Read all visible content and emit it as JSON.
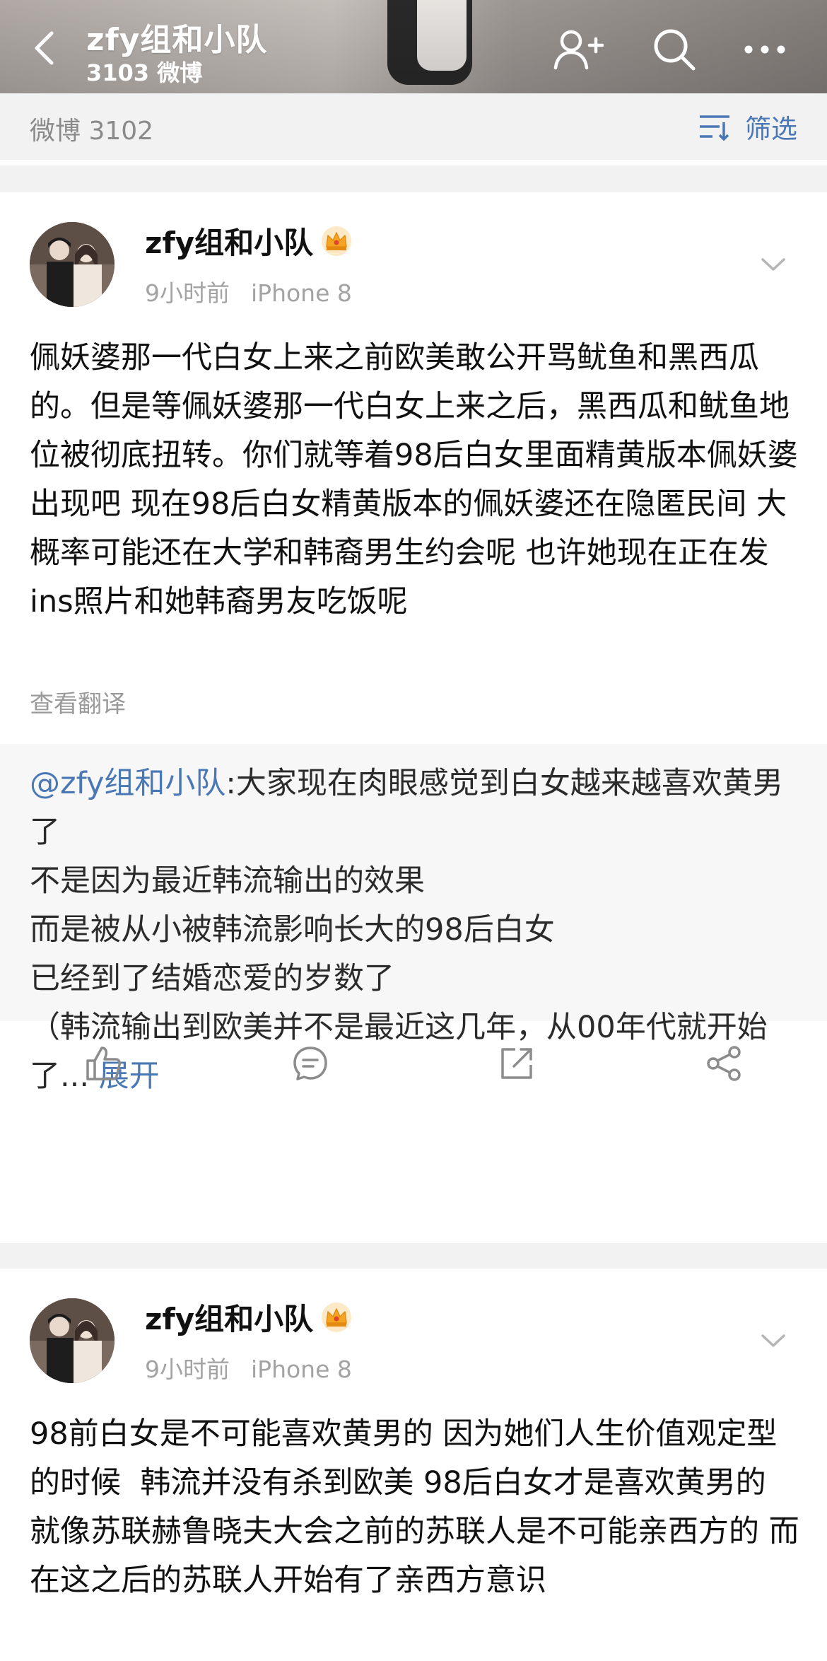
{
  "header": {
    "title": "zfy组和小队",
    "subtitle": "3103 微博"
  },
  "filter_bar": {
    "count_label": "微博 3102",
    "filter_label": "筛选"
  },
  "posts": [
    {
      "author": "zfy组和小队",
      "time": "9小时前",
      "device": "iPhone 8",
      "text": "佩妖婆那一代白女上来之前欧美敢公开骂鱿鱼和黑西瓜的。但是等佩妖婆那一代白女上来之后，黑西瓜和鱿鱼地位被彻底扭转。你们就等着98后白女里面精黄版本佩妖婆出现吧 现在98后白女精黄版本的佩妖婆还在隐匿民间 大概率可能还在大学和韩裔男生约会呢 也许她现在正在发ins照片和她韩裔男友吃饭呢",
      "translate_label": "查看翻译",
      "repost": {
        "mention": "@zfy组和小队",
        "text": ":大家现在肉眼感觉到白女越来越喜欢黄男了\n不是因为最近韩流输出的效果\n而是被从小被韩流影响长大的98后白女\n已经到了结婚恋爱的岁数了\n（韩流输出到欧美并不是最近这几年，从00年代就开始了...",
        "expand_label": "展开"
      }
    },
    {
      "author": "zfy组和小队",
      "time": "9小时前",
      "device": "iPhone 8",
      "text": "98前白女是不可能喜欢黄男的 因为她们人生价值观定型的时候  韩流并没有杀到欧美 98后白女才是喜欢黄男的 就像苏联赫鲁晓夫大会之前的苏联人是不可能亲西方的 而在这之后的苏联人开始有了亲西方意识"
    }
  ],
  "icons": [
    "back-icon",
    "add-user-icon",
    "search-icon",
    "more-icon",
    "filter-icon",
    "crown-icon",
    "chevron-down-icon",
    "like-icon",
    "comment-icon",
    "repost-icon",
    "share-icon"
  ],
  "colors": {
    "link": "#4a78b5",
    "meta": "#a3a3a3",
    "background": "#f2f2f2"
  }
}
